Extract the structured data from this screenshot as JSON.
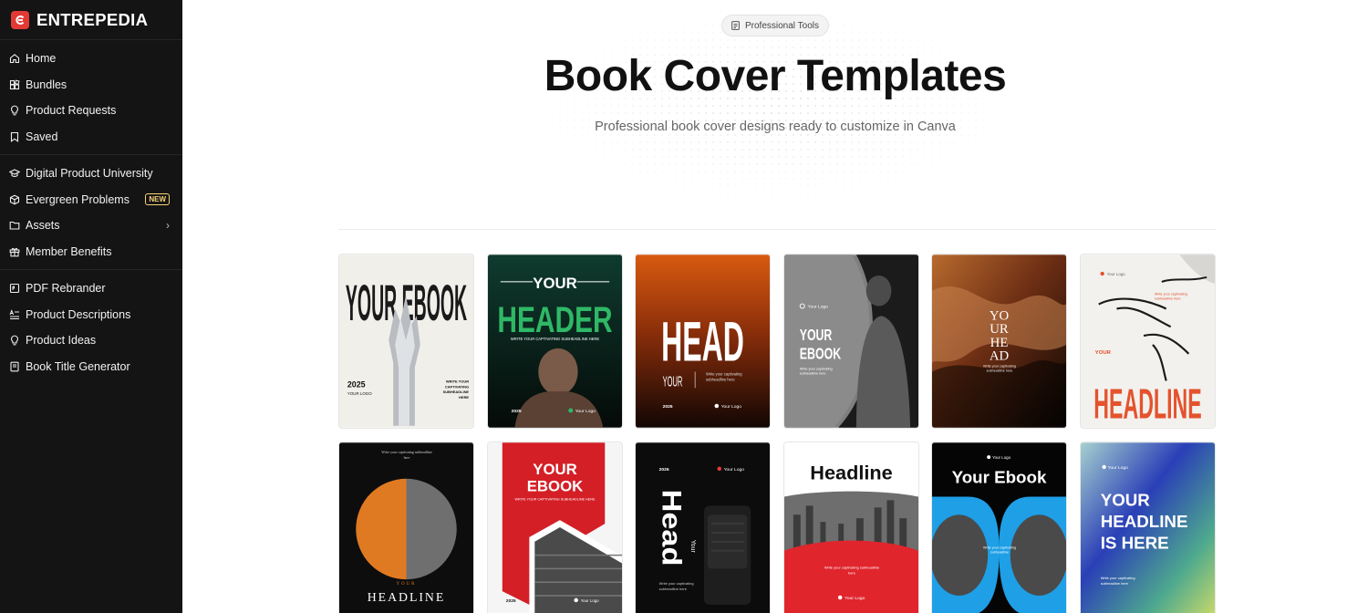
{
  "brand": {
    "name": "ENTREPEDIA",
    "accent": "#e23a35"
  },
  "sidebar": {
    "groups": [
      [
        {
          "label": "Home",
          "icon": "home-icon"
        },
        {
          "label": "Bundles",
          "icon": "bundles-icon"
        },
        {
          "label": "Product Requests",
          "icon": "lightbulb-icon"
        },
        {
          "label": "Saved",
          "icon": "bookmark-icon"
        }
      ],
      [
        {
          "label": "Digital Product University",
          "icon": "graduation-cap-icon"
        },
        {
          "label": "Evergreen Problems",
          "icon": "box-icon",
          "badge": "NEW"
        },
        {
          "label": "Assets",
          "icon": "folder-icon",
          "chevron": true
        },
        {
          "label": "Member Benefits",
          "icon": "gift-icon"
        }
      ],
      [
        {
          "label": "PDF Rebrander",
          "icon": "pdf-icon"
        },
        {
          "label": "Product Descriptions",
          "icon": "text-icon"
        },
        {
          "label": "Product Ideas",
          "icon": "lightbulb-icon"
        },
        {
          "label": "Book Title Generator",
          "icon": "book-icon"
        }
      ]
    ]
  },
  "header": {
    "pill": "Professional Tools",
    "title": "Book Cover Templates",
    "subtitle": "Professional book cover designs ready to customize in Canva"
  },
  "cards": [
    {
      "texts": [
        "YOUR EBOOK",
        "2025",
        "YOUR LOGO",
        "WRITE YOUR CAPTIVATING SUBHEADLINE HERE"
      ]
    },
    {
      "texts": [
        "YOUR",
        "HEADER",
        "WRITE YOUR CAPTIVATING SUBHEADLINE HERE",
        "2025",
        "Your Logo"
      ]
    },
    {
      "texts": [
        "HEAD",
        "YOUR",
        "Write your captivating subheadline here",
        "2025",
        "Your Logo"
      ]
    },
    {
      "texts": [
        "Your Logo",
        "YOUR",
        "EBOOK",
        "Write your captivating subheadline here"
      ]
    },
    {
      "texts": [
        "YO",
        "UR",
        "HE",
        "AD",
        "Write your captivating subheadline here"
      ]
    },
    {
      "texts": [
        "Your Logo",
        "Write your captivating subheadline here",
        "YOUR",
        "HEADLINE"
      ]
    },
    {
      "texts": [
        "Write your captivating subheadline here",
        "YOUR",
        "HEADLINE"
      ]
    },
    {
      "texts": [
        "YOUR",
        "EBOOK",
        "WRITE YOUR CAPTIVATING SUBHEADLINE HERE",
        "2025",
        "Your Logo"
      ]
    },
    {
      "texts": [
        "2025",
        "Your Logo",
        "Head",
        "Your",
        "Write your captivating subheadline here"
      ]
    },
    {
      "texts": [
        "Headline",
        "Write your captivating subheadline here",
        "Your Logo"
      ]
    },
    {
      "texts": [
        "Your Logo",
        "Your Ebook",
        "Write your captivating subheadline"
      ]
    },
    {
      "texts": [
        "Your Logo",
        "YOUR",
        "HEADLINE",
        "IS HERE",
        "Write your captivating subheadline here"
      ]
    }
  ]
}
